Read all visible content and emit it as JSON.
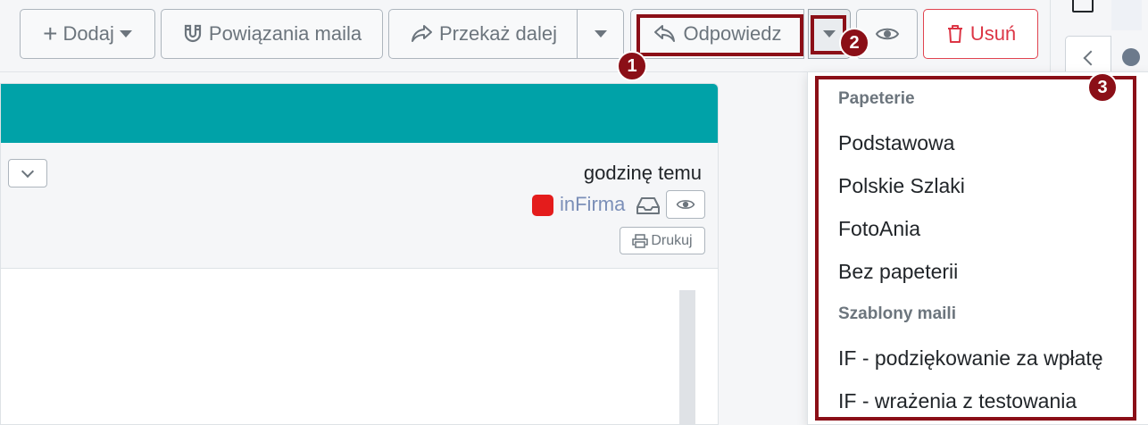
{
  "toolbar": {
    "add_label": "Dodaj",
    "links_label": "Powiązania maila",
    "forward_label": "Przekaż dalej",
    "reply_label": "Odpowiedz",
    "delete_label": "Usuń"
  },
  "message": {
    "time": "godzinę temu",
    "sender": "inFirma",
    "print_label": "Drukuj"
  },
  "dropdown": {
    "group1": "Papeterie",
    "group1_items": [
      "Podstawowa",
      "Polskie Szlaki",
      "FotoAnia",
      "Bez papeterii"
    ],
    "group2": "Szablony maili",
    "group2_items": [
      "IF - podziękowanie za wpłatę",
      "IF - wrażenia z testowania"
    ]
  },
  "annotations": [
    "1",
    "2",
    "3"
  ],
  "colors": {
    "accent_teal": "#00a2a8",
    "annotation": "#8b0f17",
    "danger": "#dc3545",
    "sender_color": "#e41c1c"
  }
}
